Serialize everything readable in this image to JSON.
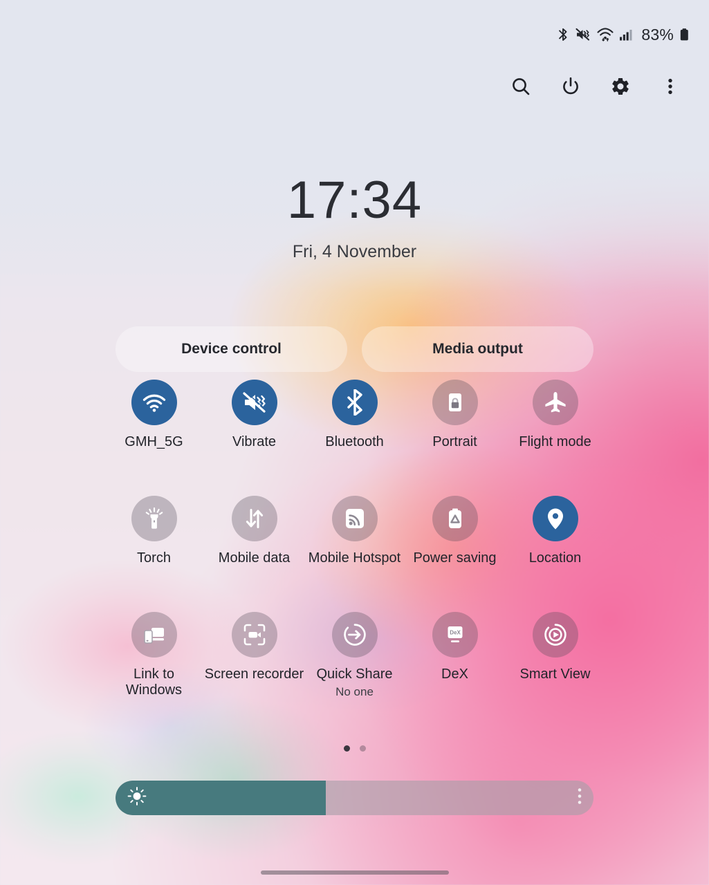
{
  "status_bar": {
    "icons": [
      "bluetooth-icon",
      "mute-vibrate-icon",
      "wifi-icon",
      "signal-icon"
    ],
    "battery_percent": "83%"
  },
  "toolbar": {
    "search_label": "search-icon",
    "power_label": "power-icon",
    "settings_label": "gear-icon",
    "more_label": "more-vertical-icon"
  },
  "clock": {
    "time": "17:34",
    "date": "Fri, 4 November"
  },
  "pills": {
    "device_control": "Device control",
    "media_output": "Media output"
  },
  "toggles": {
    "rows": [
      [
        {
          "label": "GMH_5G",
          "icon": "wifi-icon",
          "active": true,
          "sub": ""
        },
        {
          "label": "Vibrate",
          "icon": "vibrate-mute-icon",
          "active": true,
          "sub": ""
        },
        {
          "label": "Bluetooth",
          "icon": "bluetooth-icon",
          "active": true,
          "sub": ""
        },
        {
          "label": "Portrait",
          "icon": "rotation-lock-icon",
          "active": false,
          "sub": ""
        },
        {
          "label": "Flight mode",
          "icon": "airplane-icon",
          "active": false,
          "sub": ""
        }
      ],
      [
        {
          "label": "Torch",
          "icon": "flashlight-icon",
          "active": false,
          "sub": ""
        },
        {
          "label": "Mobile data",
          "icon": "data-transfer-icon",
          "active": false,
          "sub": ""
        },
        {
          "label": "Mobile Hotspot",
          "icon": "hotspot-icon",
          "active": false,
          "sub": ""
        },
        {
          "label": "Power saving",
          "icon": "battery-saver-icon",
          "active": false,
          "sub": ""
        },
        {
          "label": "Location",
          "icon": "location-pin-icon",
          "active": true,
          "sub": ""
        }
      ],
      [
        {
          "label": "Link to Windows",
          "icon": "link-to-windows-icon",
          "active": false,
          "sub": ""
        },
        {
          "label": "Screen recorder",
          "icon": "screen-recorder-icon",
          "active": false,
          "sub": ""
        },
        {
          "label": "Quick Share",
          "icon": "quick-share-icon",
          "active": false,
          "sub": "No one"
        },
        {
          "label": "DeX",
          "icon": "dex-icon",
          "active": false,
          "sub": ""
        },
        {
          "label": "Smart View",
          "icon": "smart-view-icon",
          "active": false,
          "sub": ""
        }
      ]
    ]
  },
  "pager": {
    "total_pages": 2,
    "active_page": 1
  },
  "brightness": {
    "value_percent": 44,
    "icon": "brightness-sun-icon",
    "menu_icon": "more-vertical-icon"
  },
  "colors": {
    "accent_active": "#2b639d",
    "slider_fill": "#477a7e",
    "text_primary": "#22242a"
  },
  "navigation": {
    "home_indicator": "home-indicator"
  }
}
